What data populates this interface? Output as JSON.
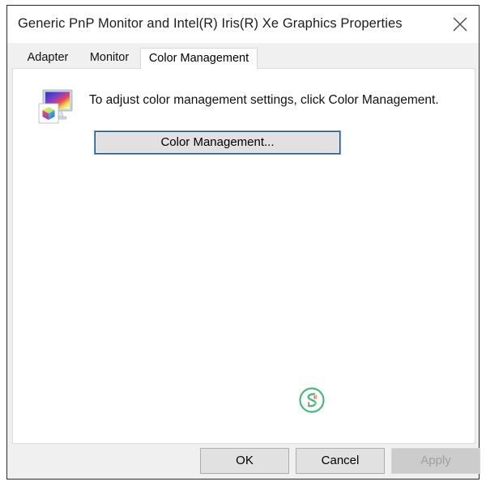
{
  "window": {
    "title": "Generic PnP Monitor and Intel(R) Iris(R) Xe Graphics Properties",
    "close_icon": "close-icon"
  },
  "tabs": [
    {
      "label": "Adapter",
      "selected": false
    },
    {
      "label": "Monitor",
      "selected": false
    },
    {
      "label": "Color Management",
      "selected": true
    }
  ],
  "content": {
    "icon": "color-monitor-icon",
    "description": "To adjust color management settings, click Color Management.",
    "color_management_button": "Color Management...",
    "watermark_icon": "green-circle-logo-icon"
  },
  "footer": {
    "ok_label": "OK",
    "cancel_label": "Cancel",
    "apply_label": "Apply",
    "apply_enabled": false
  },
  "colors": {
    "dialog_background": "#f0f0f0",
    "panel_background": "#ffffff",
    "button_face": "#e1e1e1",
    "focus_border": "#11548f",
    "disabled_text": "#a0a0a0",
    "watermark_green": "#3fae6e"
  }
}
